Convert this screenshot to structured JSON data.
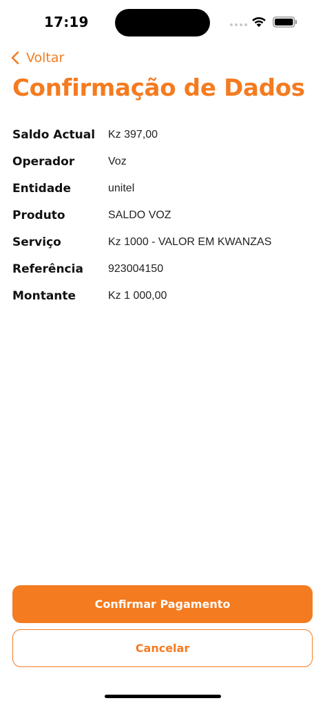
{
  "status_bar": {
    "time": "17:19",
    "icons": [
      "signal-icon",
      "wifi-icon",
      "battery-icon"
    ]
  },
  "nav": {
    "back_icon": "chevron-left-icon",
    "back_label": "Voltar"
  },
  "title": "Confirmação de Dados",
  "details": [
    {
      "label": "Saldo Actual",
      "value": "Kz 397,00"
    },
    {
      "label": "Operador",
      "value": "Voz"
    },
    {
      "label": "Entidade",
      "value": "unitel"
    },
    {
      "label": "Produto",
      "value": "SALDO VOZ"
    },
    {
      "label": "Serviço",
      "value": "Kz 1000 - VALOR EM KWANZAS"
    },
    {
      "label": "Referência",
      "value": "923004150"
    },
    {
      "label": "Montante",
      "value": "Kz 1 000,00"
    }
  ],
  "actions": {
    "confirm_label": "Confirmar Pagamento",
    "cancel_label": "Cancelar"
  },
  "colors": {
    "accent": "#f47b20",
    "text": "#111111",
    "background": "#ffffff"
  }
}
